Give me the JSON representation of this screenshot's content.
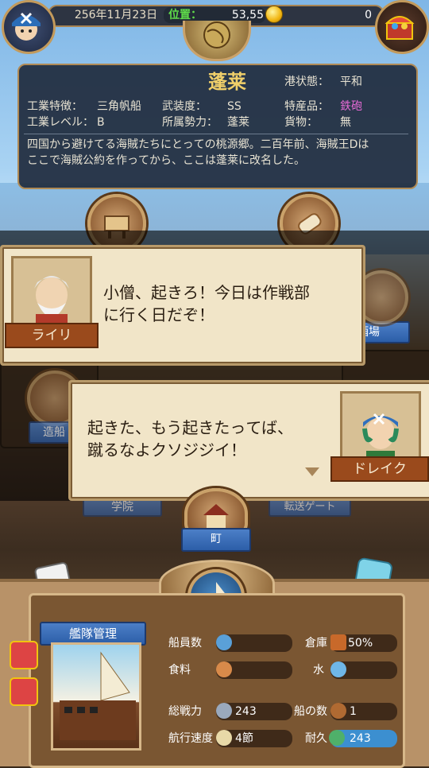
{
  "topbar": {
    "date": "256年11月23日",
    "position_label": "位置：",
    "position_value": "53,55",
    "gold_value": "0"
  },
  "port": {
    "name": "蓬莱",
    "status_label": "港状態：",
    "status_value": "平和",
    "industry_label": "工業特徴：",
    "industry_value": "三角帆船",
    "armament_label": "武装度：",
    "armament_value": "SS",
    "product_label": "特産品：",
    "product_value": "鉄砲",
    "industry_level_label": "工業レベル：",
    "industry_level_value": "B",
    "faction_label": "所属勢力：",
    "faction_value": "蓬莱",
    "cargo_label": "貨物：",
    "cargo_value": "無",
    "description_line1": "四国から避けてる海賊たちにとっての桃源郷。二百年前、海賊王Dは",
    "description_line2": "ここで海賊公約を作ってから、ここは蓬莱に改名した。"
  },
  "menu": {
    "tavern_label": "酒場",
    "shipyard_label": "造船",
    "academy_label": "学院",
    "transfer_label": "転送ゲート",
    "town_label": "町"
  },
  "dialog1": {
    "speaker": "ライリ",
    "line1": "小僧、起きろ！今日は作戦部",
    "line2": "に行く日だぞ！"
  },
  "dialog2": {
    "speaker": "ドレイク",
    "line1": "起きた、もう起きたってば、",
    "line2": "蹴るなよクソジジイ！"
  },
  "fleet": {
    "title": "艦隊管理",
    "crew_label": "船員数",
    "crew_value": "",
    "warehouse_label": "倉庫",
    "warehouse_value": "50%",
    "food_label": "食料",
    "food_value": "",
    "water_label": "水",
    "water_value": "",
    "power_label": "総戦力",
    "power_value": "243",
    "ships_label": "船の数",
    "ships_value": "1",
    "speed_label": "航行速度",
    "speed_value": "4節",
    "durability_label": "耐久",
    "durability_value": "243"
  },
  "colors": {
    "port_name": "#f0cf6a",
    "product_value": "#e76ad6",
    "position_label": "#5fdc4a",
    "nametag": "#9a4a1c",
    "tag_blue": "#2c5ea8"
  },
  "icons": [
    "captain-avatar-icon",
    "treasure-chest-icon",
    "globe-icon",
    "coin-icon",
    "workshop-icon",
    "scroll-icon",
    "bread-icon",
    "water-icon",
    "crew-icon",
    "crate-icon",
    "sword-icon",
    "ship-icon",
    "durability-icon",
    "boat-icon"
  ]
}
